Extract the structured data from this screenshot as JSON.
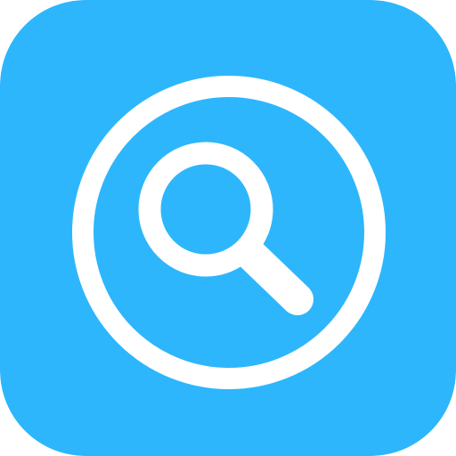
{
  "icon": {
    "name": "search-app-icon",
    "glyph": "magnifying-glass-icon",
    "background_color": "#2DB6FC",
    "foreground_color": "#FFFFFF"
  }
}
